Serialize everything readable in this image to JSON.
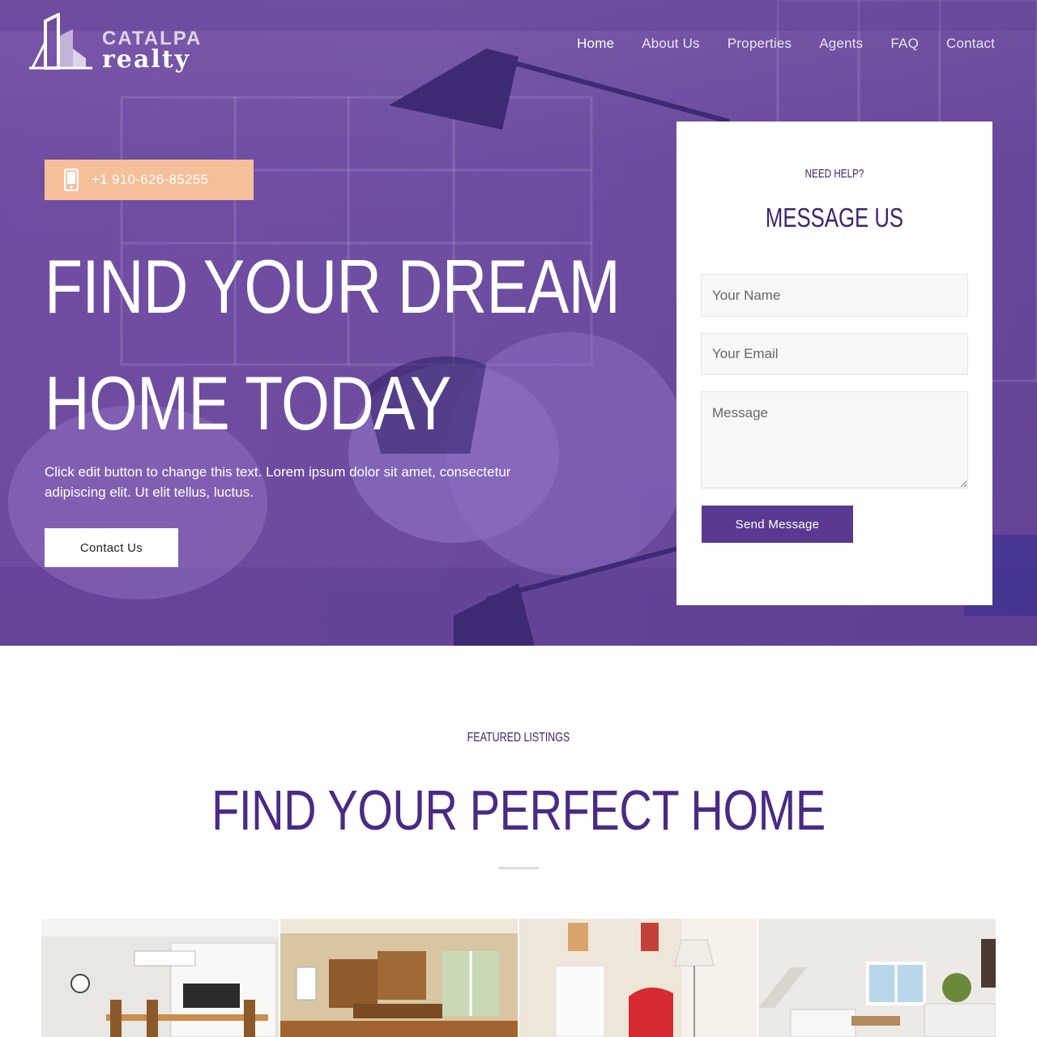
{
  "brand": {
    "name_top": "CATALPA",
    "name_bottom": "realty"
  },
  "nav": {
    "items": [
      {
        "label": "Home",
        "active": true
      },
      {
        "label": "About Us",
        "active": false
      },
      {
        "label": "Properties",
        "active": false
      },
      {
        "label": "Agents",
        "active": false
      },
      {
        "label": "FAQ",
        "active": false
      },
      {
        "label": "Contact",
        "active": false
      }
    ]
  },
  "hero": {
    "phone": "+1 910-626-85255",
    "phone_icon": "smartphone-icon",
    "title_line1": "FIND YOUR DREAM",
    "title_line2": "HOME TODAY",
    "text": "Click edit button to change this text. Lorem ipsum dolor sit amet, consectetur adipiscing elit. Ut elit tellus, luctus.",
    "cta_label": "Contact Us"
  },
  "form": {
    "eyebrow": "NEED HELP?",
    "title": "MESSAGE US",
    "name_placeholder": "Your Name",
    "email_placeholder": "Your Email",
    "message_placeholder": "Message",
    "submit_label": "Send Message"
  },
  "featured": {
    "eyebrow": "FEATURED LISTINGS",
    "title": "FIND YOUR PERFECT HOME"
  },
  "colors": {
    "accent_purple": "#5a3a90",
    "heading_purple": "#4a2a85",
    "phone_badge": "#f5bf9a",
    "hero_overlay": "#6d4da0"
  }
}
